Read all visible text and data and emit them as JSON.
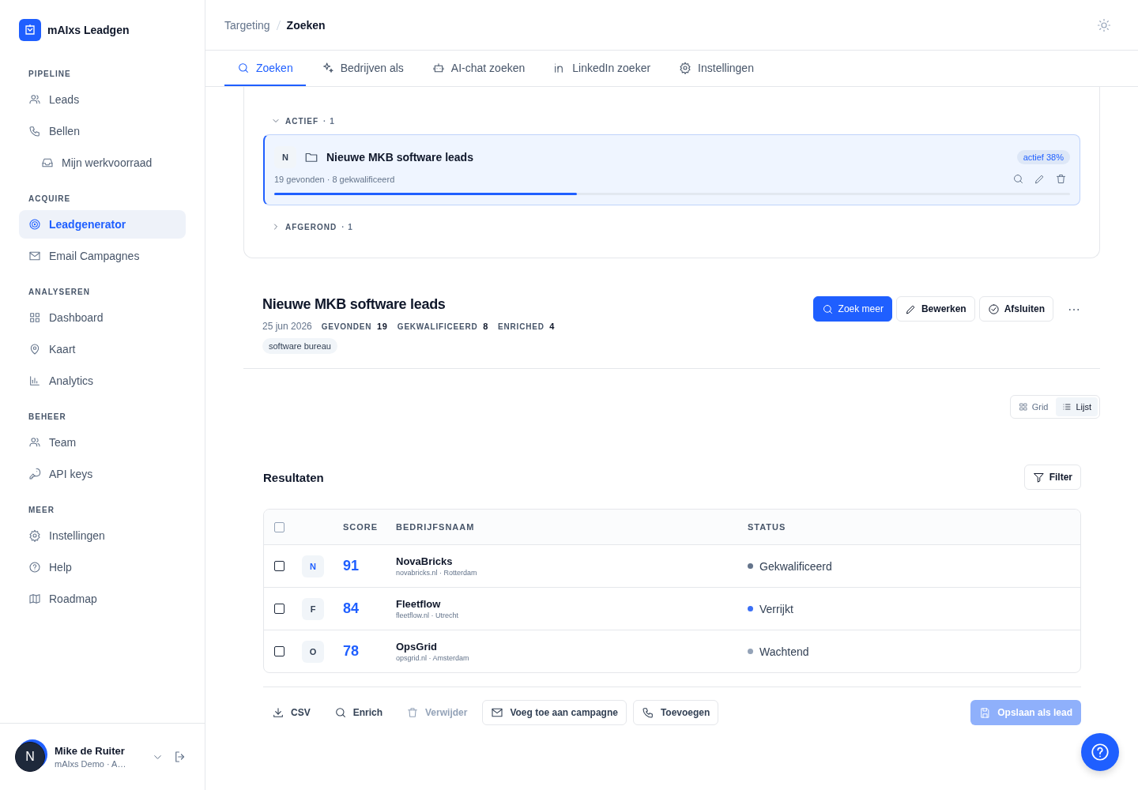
{
  "app": {
    "name": "mAIxs Leadgen"
  },
  "sidebar": {
    "sections": [
      {
        "title": "PIPELINE",
        "items": [
          {
            "label": "Leads",
            "selected": false
          },
          {
            "label": "Bellen",
            "selected": false,
            "children": [
              {
                "label": "Mijn werkvoorraad",
                "selected": false
              }
            ]
          }
        ]
      },
      {
        "title": "ACQUIRE",
        "items": [
          {
            "label": "Leadgenerator",
            "selected": true
          },
          {
            "label": "Email Campagnes",
            "selected": false
          }
        ]
      },
      {
        "title": "ANALYSEREN",
        "items": [
          {
            "label": "Dashboard",
            "selected": false
          },
          {
            "label": "Kaart",
            "selected": false
          },
          {
            "label": "Analytics",
            "selected": false
          }
        ]
      },
      {
        "title": "BEHEER",
        "items": [
          {
            "label": "Team",
            "selected": false
          },
          {
            "label": "API keys",
            "selected": false
          }
        ]
      },
      {
        "title": "MEER",
        "items": [
          {
            "label": "Instellingen",
            "selected": false
          },
          {
            "label": "Help",
            "selected": false
          },
          {
            "label": "Roadmap",
            "selected": false
          }
        ]
      }
    ]
  },
  "user": {
    "initial": "N",
    "name": "Mike de Ruiter",
    "subtitle": "mAIxs Demo · A…"
  },
  "breadcrumb": [
    "Targeting",
    "Zoeken"
  ],
  "tabs": [
    {
      "label": "Zoeken",
      "selected": true
    },
    {
      "label": "Bedrijven als",
      "selected": false
    },
    {
      "label": "AI-chat zoeken",
      "selected": false
    },
    {
      "label": "LinkedIn zoeker",
      "selected": false
    },
    {
      "label": "Instellingen",
      "selected": false
    }
  ],
  "search_groups": [
    {
      "label": "ACTIEF",
      "count": "· 1",
      "expanded": true,
      "items": [
        {
          "initial": "N",
          "title": "Nieuwe MKB software leads",
          "stats": "19 gevonden · 8 gekwalificeerd",
          "badge": "actief 38%",
          "level": 0.38
        }
      ]
    },
    {
      "label": "AFGEROND",
      "count": "· 1",
      "expanded": false
    }
  ],
  "detail": {
    "title": "Nieuwe MKB software leads",
    "date": "25 jun 2026",
    "stats": [
      {
        "label": "GEVONDEN",
        "value": "19"
      },
      {
        "label": "GEKWALIFICEERD",
        "value": "8"
      },
      {
        "label": "ENRICHED",
        "value": "4"
      }
    ],
    "tags": [
      "software bureau"
    ],
    "buttons": [
      {
        "label": "Zoek meer",
        "kind": "primary"
      },
      {
        "label": "Bewerken",
        "kind": "outline"
      },
      {
        "label": "Afsluiten",
        "kind": "outline"
      }
    ]
  },
  "view_toggle": [
    {
      "label": "Grid",
      "selected": false
    },
    {
      "label": "Lijst",
      "selected": true
    }
  ],
  "results": {
    "title": "Resultaten",
    "filter": "Filter",
    "all_checked": false,
    "columns": [
      "SCORE",
      "BEDRIJFSNAAM",
      "STATUS"
    ],
    "rows": [
      {
        "checked": false,
        "initial": "N",
        "highlighted": true,
        "score": "91",
        "name": "NovaBricks",
        "meta": "novabricks.nl · Rotterdam",
        "status": "Gekwalificeerd",
        "color": "#64748b"
      },
      {
        "checked": false,
        "initial": "F",
        "highlighted": false,
        "score": "84",
        "name": "Fleetflow",
        "meta": "fleetflow.nl · Utrecht",
        "status": "Verrijkt",
        "color": "#3b6ff5"
      },
      {
        "checked": false,
        "initial": "O",
        "highlighted": false,
        "score": "78",
        "name": "OpsGrid",
        "meta": "opsgrid.nl · Amsterdam",
        "status": "Wachtend",
        "color": "#94a3b8"
      }
    ]
  },
  "actions": [
    {
      "label": "CSV",
      "kind": "plain",
      "disabled": false
    },
    {
      "label": "Enrich",
      "kind": "plain",
      "disabled": false
    },
    {
      "label": "Verwijder",
      "kind": "plain",
      "disabled": true
    },
    {
      "label": "Voeg toe aan campagne",
      "kind": "outline",
      "disabled": false
    },
    {
      "label": "Toevoegen",
      "kind": "outline",
      "disabled": false
    }
  ],
  "save": {
    "label": "Opslaan als lead",
    "disabled": true
  }
}
